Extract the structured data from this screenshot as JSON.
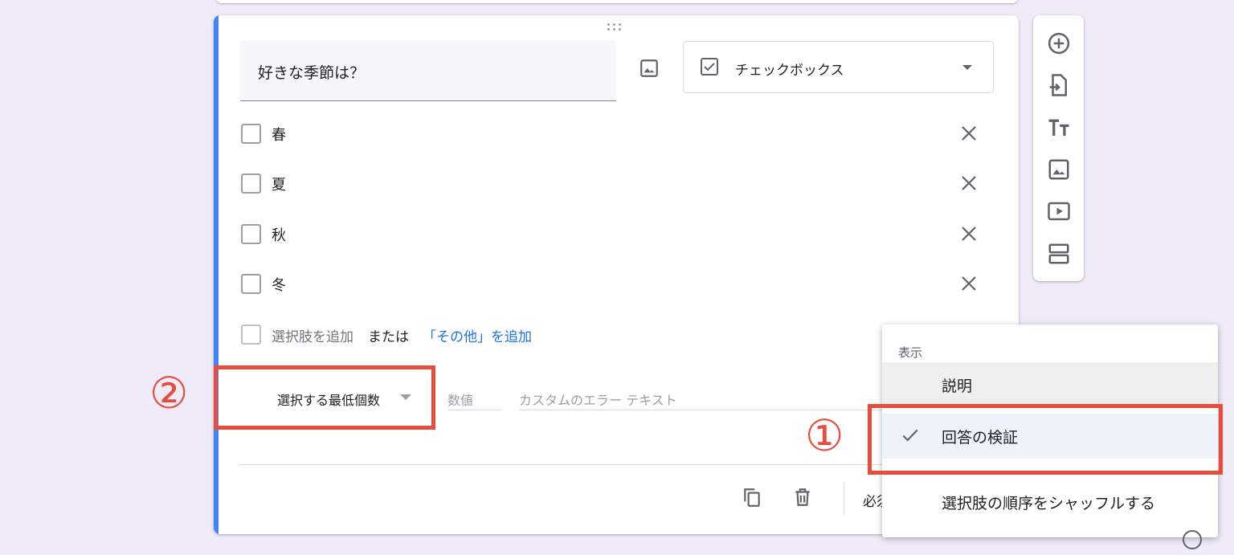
{
  "question": {
    "title": "好きな季節は？",
    "type_label": "チェックボックス",
    "options": [
      "春",
      "夏",
      "秋",
      "冬"
    ],
    "add_option": "選択肢を追加",
    "or_text": "または",
    "add_other": "「その他」を追加"
  },
  "validation": {
    "rule": "選択する最低個数",
    "number_placeholder": "数値",
    "error_placeholder": "カスタムのエラー テキスト"
  },
  "footer": {
    "required_label": "必須"
  },
  "menu": {
    "header": "表示",
    "items": [
      {
        "label": "説明",
        "checked": false
      },
      {
        "label": "回答の検証",
        "checked": true
      },
      {
        "label": "選択肢の順序をシャッフルする",
        "checked": false
      }
    ]
  },
  "annotations": {
    "one": "①",
    "two": "②"
  },
  "colors": {
    "accent": "#4285f4",
    "link": "#1a73e8",
    "annotation": "#e74c3c",
    "background": "#efebf8"
  },
  "icons": {
    "toolbar": [
      "add-question-icon",
      "import-questions-icon",
      "add-title-icon",
      "add-image-icon",
      "add-video-icon",
      "add-section-icon"
    ]
  }
}
